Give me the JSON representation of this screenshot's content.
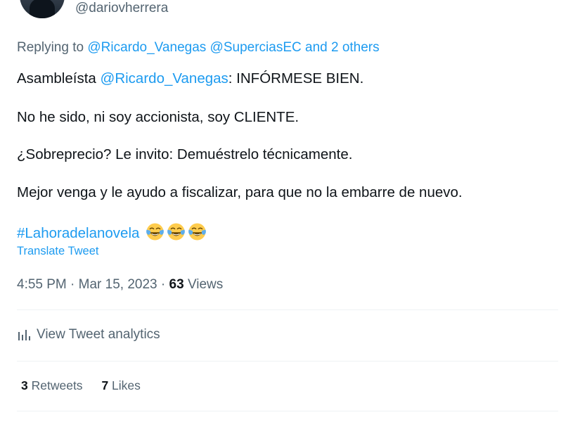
{
  "author": {
    "handle": "@dariovherrera"
  },
  "reply": {
    "prefix": "Replying to",
    "mention1": "@Ricardo_Vanegas",
    "mention2": "@SuperciasEC",
    "others": "and 2 others"
  },
  "tweet": {
    "p1_start": "Asambleísta",
    "p1_mention": "@Ricardo_Vanegas",
    "p1_end": ": INFÓRMESE BIEN.",
    "p2": "No he sido, ni soy accionista, soy CLIENTE.",
    "p3": "¿Sobreprecio? Le invito: Demuéstrelo técnicamente.",
    "p4": "Mejor venga y le ayudo a fiscalizar, para que no la embarre de nuevo.",
    "hashtag": "#Lahoradelanovela",
    "emoji": "face-with-tears-of-joy",
    "emoji_count": 3
  },
  "translate_label": "Translate Tweet",
  "meta": {
    "time": "4:55 PM",
    "date": "Mar 15, 2023",
    "views_count": "63",
    "views_label": "Views"
  },
  "analytics_label": "View Tweet analytics",
  "stats": {
    "retweets_count": "3",
    "retweets_label": "Retweets",
    "likes_count": "7",
    "likes_label": "Likes"
  },
  "colors": {
    "link": "#1d9bf0",
    "muted": "#536471",
    "text": "#0f1419",
    "divider": "#eff3f4"
  }
}
